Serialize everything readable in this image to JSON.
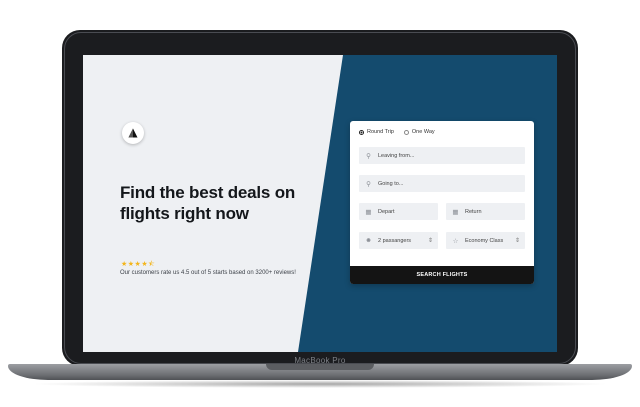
{
  "device": {
    "model_label": "MacBook Pro"
  },
  "hero": {
    "logo_icon": "triangle-logo-icon",
    "headline": "Find the best deals on flights right now",
    "stars": "★★★★⯪",
    "rating_value": 4.5,
    "rating_text": "Our customers rate us 4.5 out of 5 starts based on 3200+ reviews!"
  },
  "booking": {
    "trip_types": [
      {
        "label": "Round Trip",
        "selected": true
      },
      {
        "label": "One Way",
        "selected": false
      }
    ],
    "leaving_placeholder": "Leaving from...",
    "going_placeholder": "Going to...",
    "depart_placeholder": "Depart",
    "return_placeholder": "Return",
    "passengers_value": "2 passangers",
    "class_value": "Economy Class",
    "search_label": "SEARCH FLIGHTS"
  },
  "colors": {
    "accent_panel": "#144b6e",
    "left_panel": "#eef0f3",
    "button": "#141414",
    "stars": "#f3b51b"
  }
}
